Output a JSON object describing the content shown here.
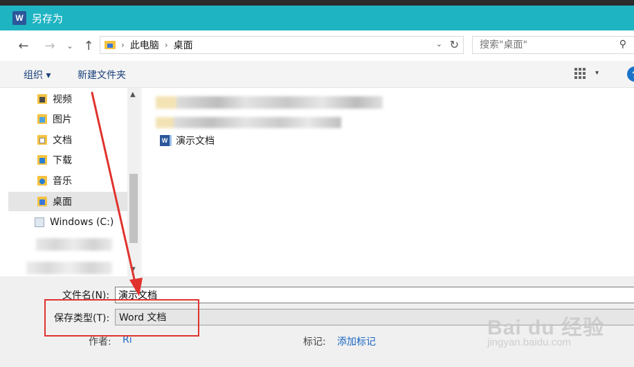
{
  "window": {
    "title": "另存为",
    "app_icon": "W"
  },
  "nav": {
    "back": "←",
    "forward": "→",
    "recent": "⌄",
    "up": "↑",
    "breadcrumb": [
      "此电脑",
      "桌面"
    ],
    "separator": "›",
    "dropdown": "⌄",
    "refresh": "↻"
  },
  "search": {
    "placeholder": "搜索\"桌面\"",
    "icon": "⚲"
  },
  "toolbar": {
    "organize": "组织 ▾",
    "new_folder": "新建文件夹",
    "view_dropdown": "▾",
    "help": "?"
  },
  "sidebar": {
    "items": [
      {
        "label": "视频",
        "icon": "video-folder-icon"
      },
      {
        "label": "图片",
        "icon": "pictures-folder-icon"
      },
      {
        "label": "文档",
        "icon": "documents-folder-icon"
      },
      {
        "label": "下载",
        "icon": "downloads-folder-icon"
      },
      {
        "label": "音乐",
        "icon": "music-folder-icon"
      },
      {
        "label": "桌面",
        "icon": "desktop-folder-icon",
        "selected": true
      },
      {
        "label": "Windows (C:)",
        "icon": "drive-icon"
      }
    ]
  },
  "scroll": {
    "up": "▲",
    "down": "▼"
  },
  "files": [
    {
      "name": "演示文档",
      "icon": "word-doc-icon",
      "icon_letter": "W"
    }
  ],
  "form": {
    "filename_label": "文件名(N):",
    "filename_value": "演示文档",
    "filetype_label": "保存类型(T):",
    "filetype_value": "Word 文档",
    "author_label": "作者:",
    "author_value": "Ri",
    "tags_label": "标记:",
    "tags_value": "添加标记"
  },
  "watermark": {
    "brand": "Bai du 经验",
    "site": "jingyan.baidu.com"
  },
  "colors": {
    "titlebar": "#1eb4c2",
    "annotation": "#e0322d",
    "link": "#1a66c2"
  }
}
